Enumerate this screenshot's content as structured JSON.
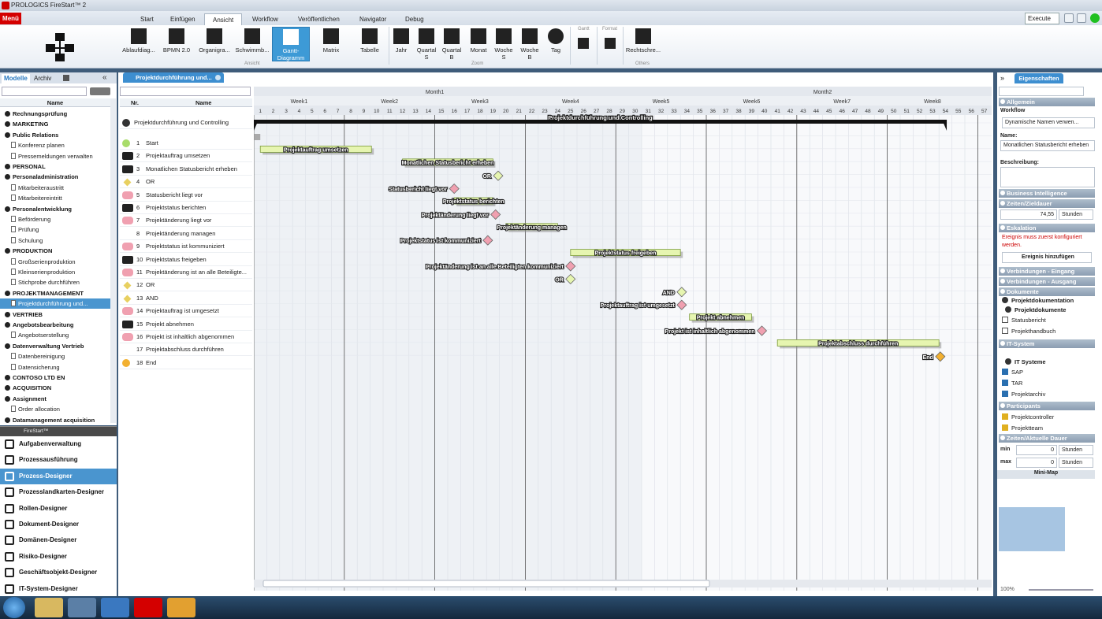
{
  "app": {
    "title": "PROLOGICS FireStart™ 2"
  },
  "ribbon": {
    "menu_label": "Menü",
    "tabs": [
      "Start",
      "Einfügen",
      "Ansicht",
      "Workflow",
      "Veröffentlichen",
      "Navigator",
      "Debug"
    ],
    "active_tab": "Ansicht",
    "execute_label": "Execute",
    "buttons": {
      "ablauf": "Ablaufdiag...",
      "bpmn": "BPMN 2.0",
      "organi": "Organigra...",
      "schwimm": "Schwimmb...",
      "gantt": "Gantt-Diagramm",
      "matrix": "Matrix",
      "tabelle": "Tabelle",
      "jahr": "Jahr",
      "quartals": "Quartal S",
      "quartalb": "Quartal B",
      "monat": "Monat",
      "woches": "Woche S",
      "wocheb": "Woche B",
      "tag": "Tag",
      "rechtschreibung": "Rechtschre..."
    },
    "groups": {
      "ansicht": "Ansicht",
      "zoom": "Zoom",
      "others": "Others",
      "gantt": "Gantt",
      "format": "Format"
    }
  },
  "left_panel": {
    "tabs": [
      "Modelle",
      "Archiv"
    ],
    "active_tab": "Modelle",
    "column_header": "Name",
    "tree": [
      {
        "label": "Rechnungsprüfung",
        "kind": "group"
      },
      {
        "label": "MARKETING",
        "kind": "group"
      },
      {
        "label": "Public Relations",
        "kind": "group"
      },
      {
        "label": "Konferenz planen",
        "kind": "item"
      },
      {
        "label": "Pressemeldungen verwalten",
        "kind": "item"
      },
      {
        "label": "PERSONAL",
        "kind": "group"
      },
      {
        "label": "Personaladministration",
        "kind": "group"
      },
      {
        "label": "Mitarbeiteraustritt",
        "kind": "item"
      },
      {
        "label": "Mitarbeitereintritt",
        "kind": "item"
      },
      {
        "label": "Personalentwicklung",
        "kind": "group"
      },
      {
        "label": "Beförderung",
        "kind": "item"
      },
      {
        "label": "Prüfung",
        "kind": "item"
      },
      {
        "label": "Schulung",
        "kind": "item"
      },
      {
        "label": "PRODUKTION",
        "kind": "group"
      },
      {
        "label": "Großserienproduktion",
        "kind": "item"
      },
      {
        "label": "Kleinserienproduktion",
        "kind": "item"
      },
      {
        "label": "Stichprobe durchführen",
        "kind": "item"
      },
      {
        "label": "PROJEKTMANAGEMENT",
        "kind": "group"
      },
      {
        "label": "Projektdurchführung und...",
        "kind": "selected"
      },
      {
        "label": "VERTRIEB",
        "kind": "group"
      },
      {
        "label": "Angebotsbearbeitung",
        "kind": "group"
      },
      {
        "label": "Angebotserstellung",
        "kind": "item"
      },
      {
        "label": "Datenverwaltung Vertrieb",
        "kind": "group"
      },
      {
        "label": "Datenbereinigung",
        "kind": "item"
      },
      {
        "label": "Datensicherung",
        "kind": "item"
      },
      {
        "label": "CONTOSO LTD EN",
        "kind": "group"
      },
      {
        "label": "ACQUISITION",
        "kind": "group"
      },
      {
        "label": "Assignment",
        "kind": "group"
      },
      {
        "label": "Order allocation",
        "kind": "item"
      },
      {
        "label": "Datamanagement acquisition",
        "kind": "group"
      }
    ]
  },
  "designers": {
    "header": "FireStart™",
    "items": [
      "Aufgabenverwaltung",
      "Prozessausführung",
      "Prozess-Designer",
      "Prozesslandkarten-Designer",
      "Rollen-Designer",
      "Dokument-Designer",
      "Domänen-Designer",
      "Risiko-Designer",
      "Geschäftsobjekt-Designer",
      "IT-System-Designer"
    ],
    "active": "Prozess-Designer"
  },
  "document": {
    "tab_label": "Projektdurchführung und...",
    "columns": {
      "nr": "Nr.",
      "name": "Name"
    },
    "root_label": "Projektdurchführung und Controlling",
    "rows": [
      {
        "nr": "1",
        "name": "Start",
        "sym": "start"
      },
      {
        "nr": "2",
        "name": "Projektauftrag umsetzen",
        "sym": "task"
      },
      {
        "nr": "3",
        "name": "Monatlichen Statusbericht erheben",
        "sym": "task"
      },
      {
        "nr": "4",
        "name": "OR",
        "sym": "gateway"
      },
      {
        "nr": "5",
        "name": "Statusbericht liegt vor",
        "sym": "event"
      },
      {
        "nr": "6",
        "name": "Projektstatus berichten",
        "sym": "task"
      },
      {
        "nr": "7",
        "name": "Projektänderung liegt vor",
        "sym": "event"
      },
      {
        "nr": "8",
        "name": "Projektänderung managen",
        "sym": "none"
      },
      {
        "nr": "9",
        "name": "Projektstatus ist kommuniziert",
        "sym": "event"
      },
      {
        "nr": "10",
        "name": "Projektstatus freigeben",
        "sym": "task"
      },
      {
        "nr": "11",
        "name": "Projektänderung ist an alle Beteiligte...",
        "sym": "event"
      },
      {
        "nr": "12",
        "name": "OR",
        "sym": "gateway"
      },
      {
        "nr": "13",
        "name": "AND",
        "sym": "gateway"
      },
      {
        "nr": "14",
        "name": "Projektauftrag ist umgesetzt",
        "sym": "event"
      },
      {
        "nr": "15",
        "name": "Projekt abnehmen",
        "sym": "task"
      },
      {
        "nr": "16",
        "name": "Projekt ist inhaltlich abgenommen",
        "sym": "event"
      },
      {
        "nr": "17",
        "name": "Projektabschluss durchführen",
        "sym": "none"
      },
      {
        "nr": "18",
        "name": "End",
        "sym": "end"
      }
    ]
  },
  "gantt": {
    "months": [
      "Month1",
      "Month2"
    ],
    "weeks": [
      "Week1",
      "Week2",
      "Week3",
      "Week4",
      "Week5",
      "Week6",
      "Week7",
      "Week8"
    ],
    "days": [
      "1",
      "2",
      "3",
      "4",
      "5",
      "6",
      "7",
      "8",
      "9",
      "10",
      "11",
      "12",
      "13",
      "14",
      "15",
      "16",
      "17",
      "18",
      "19",
      "20",
      "21",
      "22",
      "23",
      "24",
      "25",
      "26",
      "27",
      "28",
      "29",
      "30",
      "31",
      "32",
      "33",
      "34",
      "35",
      "36",
      "37",
      "38",
      "39",
      "40",
      "41",
      "42",
      "43",
      "44",
      "45",
      "46",
      "47",
      "48",
      "49",
      "50",
      "51",
      "52",
      "53",
      "54",
      "55",
      "56",
      "57"
    ],
    "summary_label": "Projektdurchführung und Controlling",
    "summary": {
      "start": 1,
      "end": 54
    },
    "items": [
      {
        "label": "Start",
        "type": "start",
        "start": 1,
        "end": 1
      },
      {
        "label": "Projektauftrag umsetzen",
        "type": "task",
        "start": 1,
        "end": 9.6
      },
      {
        "label": "Monatlichen Statusbericht erheben",
        "type": "task",
        "start": 12,
        "end": 19
      },
      {
        "label": "OR",
        "type": "gateway",
        "start": 19.4,
        "end": 19.4
      },
      {
        "label": "Statusbericht liegt vor",
        "type": "event",
        "start": 16,
        "end": 16
      },
      {
        "label": "Projektstatus berichten",
        "type": "task",
        "start": 16,
        "end": 19
      },
      {
        "label": "Projektänderung liegt vor",
        "type": "event",
        "start": 19.2,
        "end": 19.2
      },
      {
        "label": "Projektänderung managen",
        "type": "task",
        "start": 20,
        "end": 24
      },
      {
        "label": "Projektstatus ist kommuniziert",
        "type": "event",
        "start": 18.6,
        "end": 18.6
      },
      {
        "label": "Projektstatus freigeben",
        "type": "task",
        "start": 25,
        "end": 33.5
      },
      {
        "label": "Projektänderung ist an alle Beteiligten kommuniziert",
        "type": "event",
        "start": 25,
        "end": 25
      },
      {
        "label": "OR",
        "type": "gateway",
        "start": 25,
        "end": 25
      },
      {
        "label": "AND",
        "type": "gateway",
        "start": 33.6,
        "end": 33.6
      },
      {
        "label": "Projektauftrag ist umgesetzt",
        "type": "event",
        "start": 33.6,
        "end": 33.6
      },
      {
        "label": "Projekt abnehmen",
        "type": "task",
        "start": 34.2,
        "end": 39
      },
      {
        "label": "Projekt ist inhaltlich abgenommen",
        "type": "event",
        "start": 39.8,
        "end": 39.8
      },
      {
        "label": "Projektabschluss durchführen",
        "type": "task",
        "start": 41,
        "end": 53.5
      },
      {
        "label": "End",
        "type": "end",
        "start": 53.6,
        "end": 53.6
      }
    ]
  },
  "properties": {
    "tab_label": "Eigenschaften",
    "sections": {
      "allgemein": "Allgemein",
      "workflow": "Workflow",
      "dyn_names": "Dynamische Namen verwen...",
      "name_label": "Name:",
      "name_value": "Monatlichen Statusbericht erheben",
      "beschreibung_label": "Beschreibung:",
      "bi": "Business Intelligence",
      "zeiten_ziel": "Zeiten/Zieldauer",
      "ziel_value": "74,55",
      "unit": "Stunden",
      "eskalation": "Eskalation",
      "eskalation_warn": "Ereignis muss zuerst konfiguriert werden.",
      "ereignis_btn": "Ereignis hinzufügen",
      "verb_ein": "Verbindungen - Eingang",
      "verb_aus": "Verbindungen - Ausgang",
      "dokumente": "Dokumente",
      "projektdoku": "Projektdokumentation",
      "projektdokumente": "Projektdokumente",
      "statusbericht": "Statusbericht",
      "projekthandbuch": "Projekthandbuch",
      "it_system": "IT-System",
      "it_system_sub": "IT Systeme",
      "sap": "SAP",
      "tar": "TAR",
      "projektarchiv": "Projektarchiv",
      "participants": "Participants",
      "projektcontroller": "Projektcontroller",
      "projektteam": "Projektteam",
      "zeiten_akt": "Zeiten/Aktuelle Dauer",
      "min_label": "min",
      "max_label": "max",
      "min_value": "0",
      "max_value": "0",
      "minimap": "Mini-Map",
      "zoom": "100%"
    }
  },
  "colors": {
    "accent": "#3d8ed0",
    "task_fill": "#e6f5b0",
    "event_fill": "#f0a0b0",
    "gateway_fill": "#e6f5b0",
    "end_fill": "#f2b030",
    "start_fill": "#a8dc6a"
  }
}
